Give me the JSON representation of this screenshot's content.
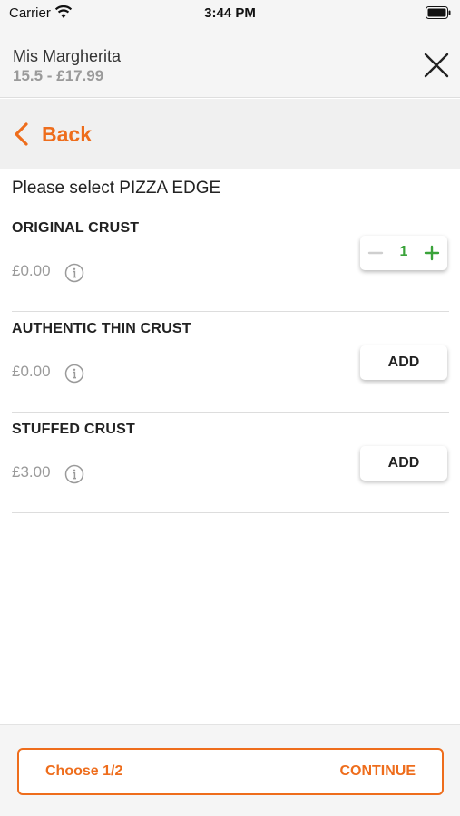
{
  "status_bar": {
    "carrier": "Carrier",
    "time": "3:44 PM"
  },
  "header": {
    "item_name": "Mis Margherita",
    "price_range": "15.5 - £17.99"
  },
  "back": {
    "label": "Back"
  },
  "section": {
    "title": "Please select PIZZA EDGE"
  },
  "options": [
    {
      "name": "ORIGINAL CRUST",
      "price": "£0.00",
      "quantity": "1"
    },
    {
      "name": "AUTHENTIC THIN CRUST",
      "price": "£0.00",
      "add_label": "ADD"
    },
    {
      "name": "STUFFED CRUST",
      "price": "£3.00",
      "add_label": "ADD"
    }
  ],
  "footer": {
    "choose_label": "Choose 1/2",
    "continue_label": "CONTINUE"
  },
  "colors": {
    "accent": "#ee6d1c",
    "stepper_green": "#3aa33a",
    "muted": "#9a9a9a"
  }
}
